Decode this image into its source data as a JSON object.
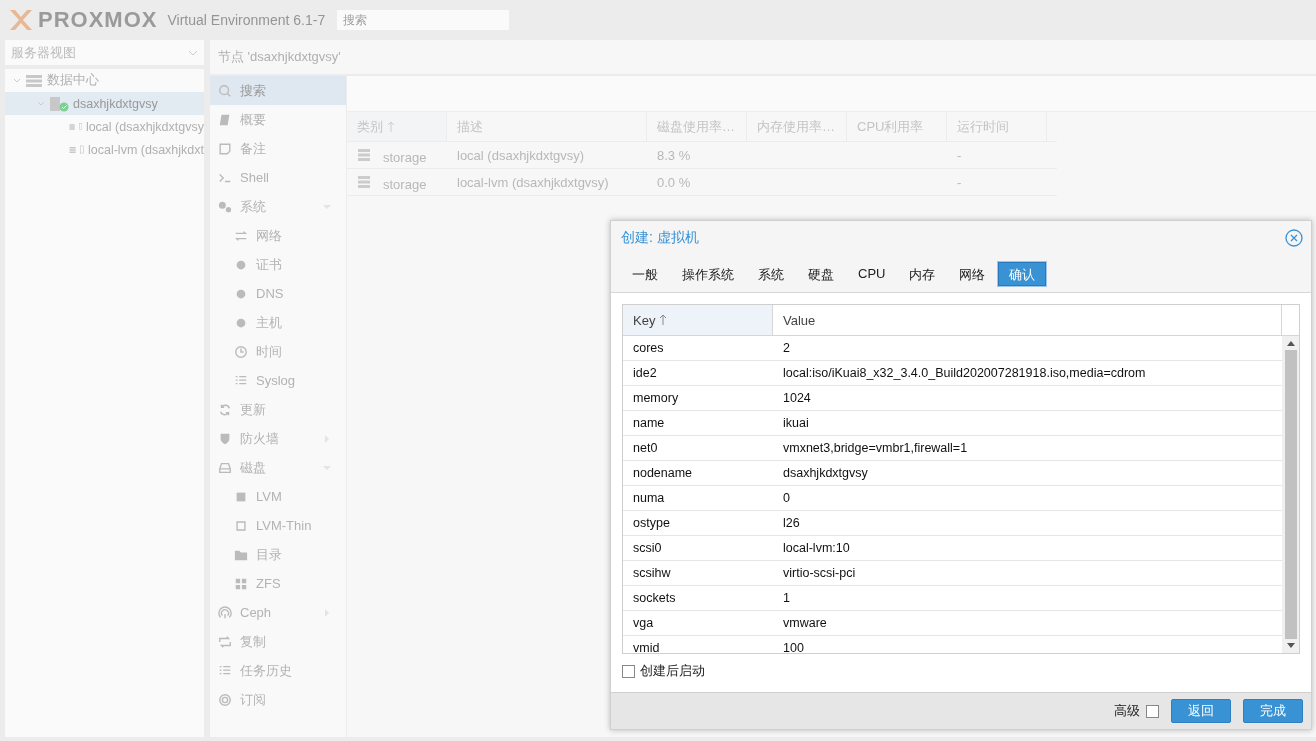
{
  "header": {
    "logo": "PROXMOX",
    "version": "Virtual Environment 6.1-7",
    "search": {
      "placeholder": "搜索"
    }
  },
  "sidebar": {
    "view_selector": "服务器视图",
    "tree": [
      {
        "label": "数据中心",
        "kind": "datacenter",
        "expanded": true,
        "selected": false,
        "children": [
          {
            "label": "dsaxhjkdxtgvsy",
            "kind": "node",
            "expanded": true,
            "selected": true,
            "children": [
              {
                "label": "local (dsaxhjkdxtgvsy",
                "kind": "storage",
                "selected": false
              },
              {
                "label": "local-lvm (dsaxhjkdxt",
                "kind": "storage",
                "selected": false
              }
            ]
          }
        ]
      }
    ]
  },
  "node_panel": {
    "title": "节点 'dsaxhjkdxtgvsy'",
    "menu": [
      {
        "label": "搜索",
        "selected": true
      },
      {
        "label": "概要",
        "selected": false
      },
      {
        "label": "备注",
        "selected": false
      },
      {
        "label": "Shell",
        "selected": false
      },
      {
        "label": "系统",
        "selected": false,
        "expanded": true,
        "children": [
          {
            "label": "网络",
            "selected": false
          },
          {
            "label": "证书",
            "selected": false
          },
          {
            "label": "DNS",
            "selected": false
          },
          {
            "label": "主机",
            "selected": false
          },
          {
            "label": "时间",
            "selected": false
          },
          {
            "label": "Syslog",
            "selected": false
          }
        ]
      },
      {
        "label": "更新",
        "selected": false
      },
      {
        "label": "防火墙",
        "selected": false,
        "expanded": false
      },
      {
        "label": "磁盘",
        "selected": false,
        "expanded": true,
        "children": [
          {
            "label": "LVM",
            "selected": false
          },
          {
            "label": "LVM-Thin",
            "selected": false
          },
          {
            "label": "目录",
            "selected": false
          },
          {
            "label": "ZFS",
            "selected": false
          }
        ]
      },
      {
        "label": "Ceph",
        "selected": false,
        "expanded": false
      },
      {
        "label": "复制",
        "selected": false
      },
      {
        "label": "任务历史",
        "selected": false
      },
      {
        "label": "订阅",
        "selected": false
      }
    ],
    "table": {
      "columns": [
        {
          "label": "类别",
          "sorted": true
        },
        {
          "label": "描述",
          "sorted": false
        },
        {
          "label": "磁盘使用率…",
          "sorted": false
        },
        {
          "label": "内存使用率…",
          "sorted": false
        },
        {
          "label": "CPU利用率",
          "sorted": false
        },
        {
          "label": "运行时间",
          "sorted": false
        }
      ],
      "rows": [
        {
          "type": "storage",
          "description": "local (dsaxhjkdxtgvsy)",
          "disk_usage": "8.3 %",
          "uptime": "-"
        },
        {
          "type": "storage",
          "description": "local-lvm (dsaxhjkdxtgvsy)",
          "disk_usage": "0.0 %",
          "uptime": "-"
        }
      ]
    }
  },
  "dialog": {
    "title": "创建: 虚拟机",
    "tabs": [
      {
        "label": "一般",
        "selected": false
      },
      {
        "label": "操作系统",
        "selected": false
      },
      {
        "label": "系统",
        "selected": false
      },
      {
        "label": "硬盘",
        "selected": false
      },
      {
        "label": "CPU",
        "selected": false
      },
      {
        "label": "内存",
        "selected": false
      },
      {
        "label": "网络",
        "selected": false
      },
      {
        "label": "确认",
        "selected": true
      }
    ],
    "table": {
      "columns": [
        {
          "label": "Key",
          "sorted": true
        },
        {
          "label": "Value",
          "sorted": false
        }
      ],
      "rows": [
        {
          "key": "cores",
          "value": "2"
        },
        {
          "key": "ide2",
          "value": "local:iso/iKuai8_x32_3.4.0_Build202007281918.iso,media=cdrom"
        },
        {
          "key": "memory",
          "value": "1024"
        },
        {
          "key": "name",
          "value": "ikuai"
        },
        {
          "key": "net0",
          "value": "vmxnet3,bridge=vmbr1,firewall=1"
        },
        {
          "key": "nodename",
          "value": "dsaxhjkdxtgvsy"
        },
        {
          "key": "numa",
          "value": "0"
        },
        {
          "key": "ostype",
          "value": "l26"
        },
        {
          "key": "scsi0",
          "value": "local-lvm:10"
        },
        {
          "key": "scsihw",
          "value": "virtio-scsi-pci"
        },
        {
          "key": "sockets",
          "value": "1"
        },
        {
          "key": "vga",
          "value": "vmware"
        },
        {
          "key": "vmid",
          "value": "100"
        }
      ]
    },
    "start_after_create": {
      "label": "创建后启动",
      "checked": false
    },
    "advanced": {
      "label": "高级",
      "checked": false
    },
    "buttons": [
      {
        "label": "返回"
      },
      {
        "label": "完成"
      }
    ]
  }
}
